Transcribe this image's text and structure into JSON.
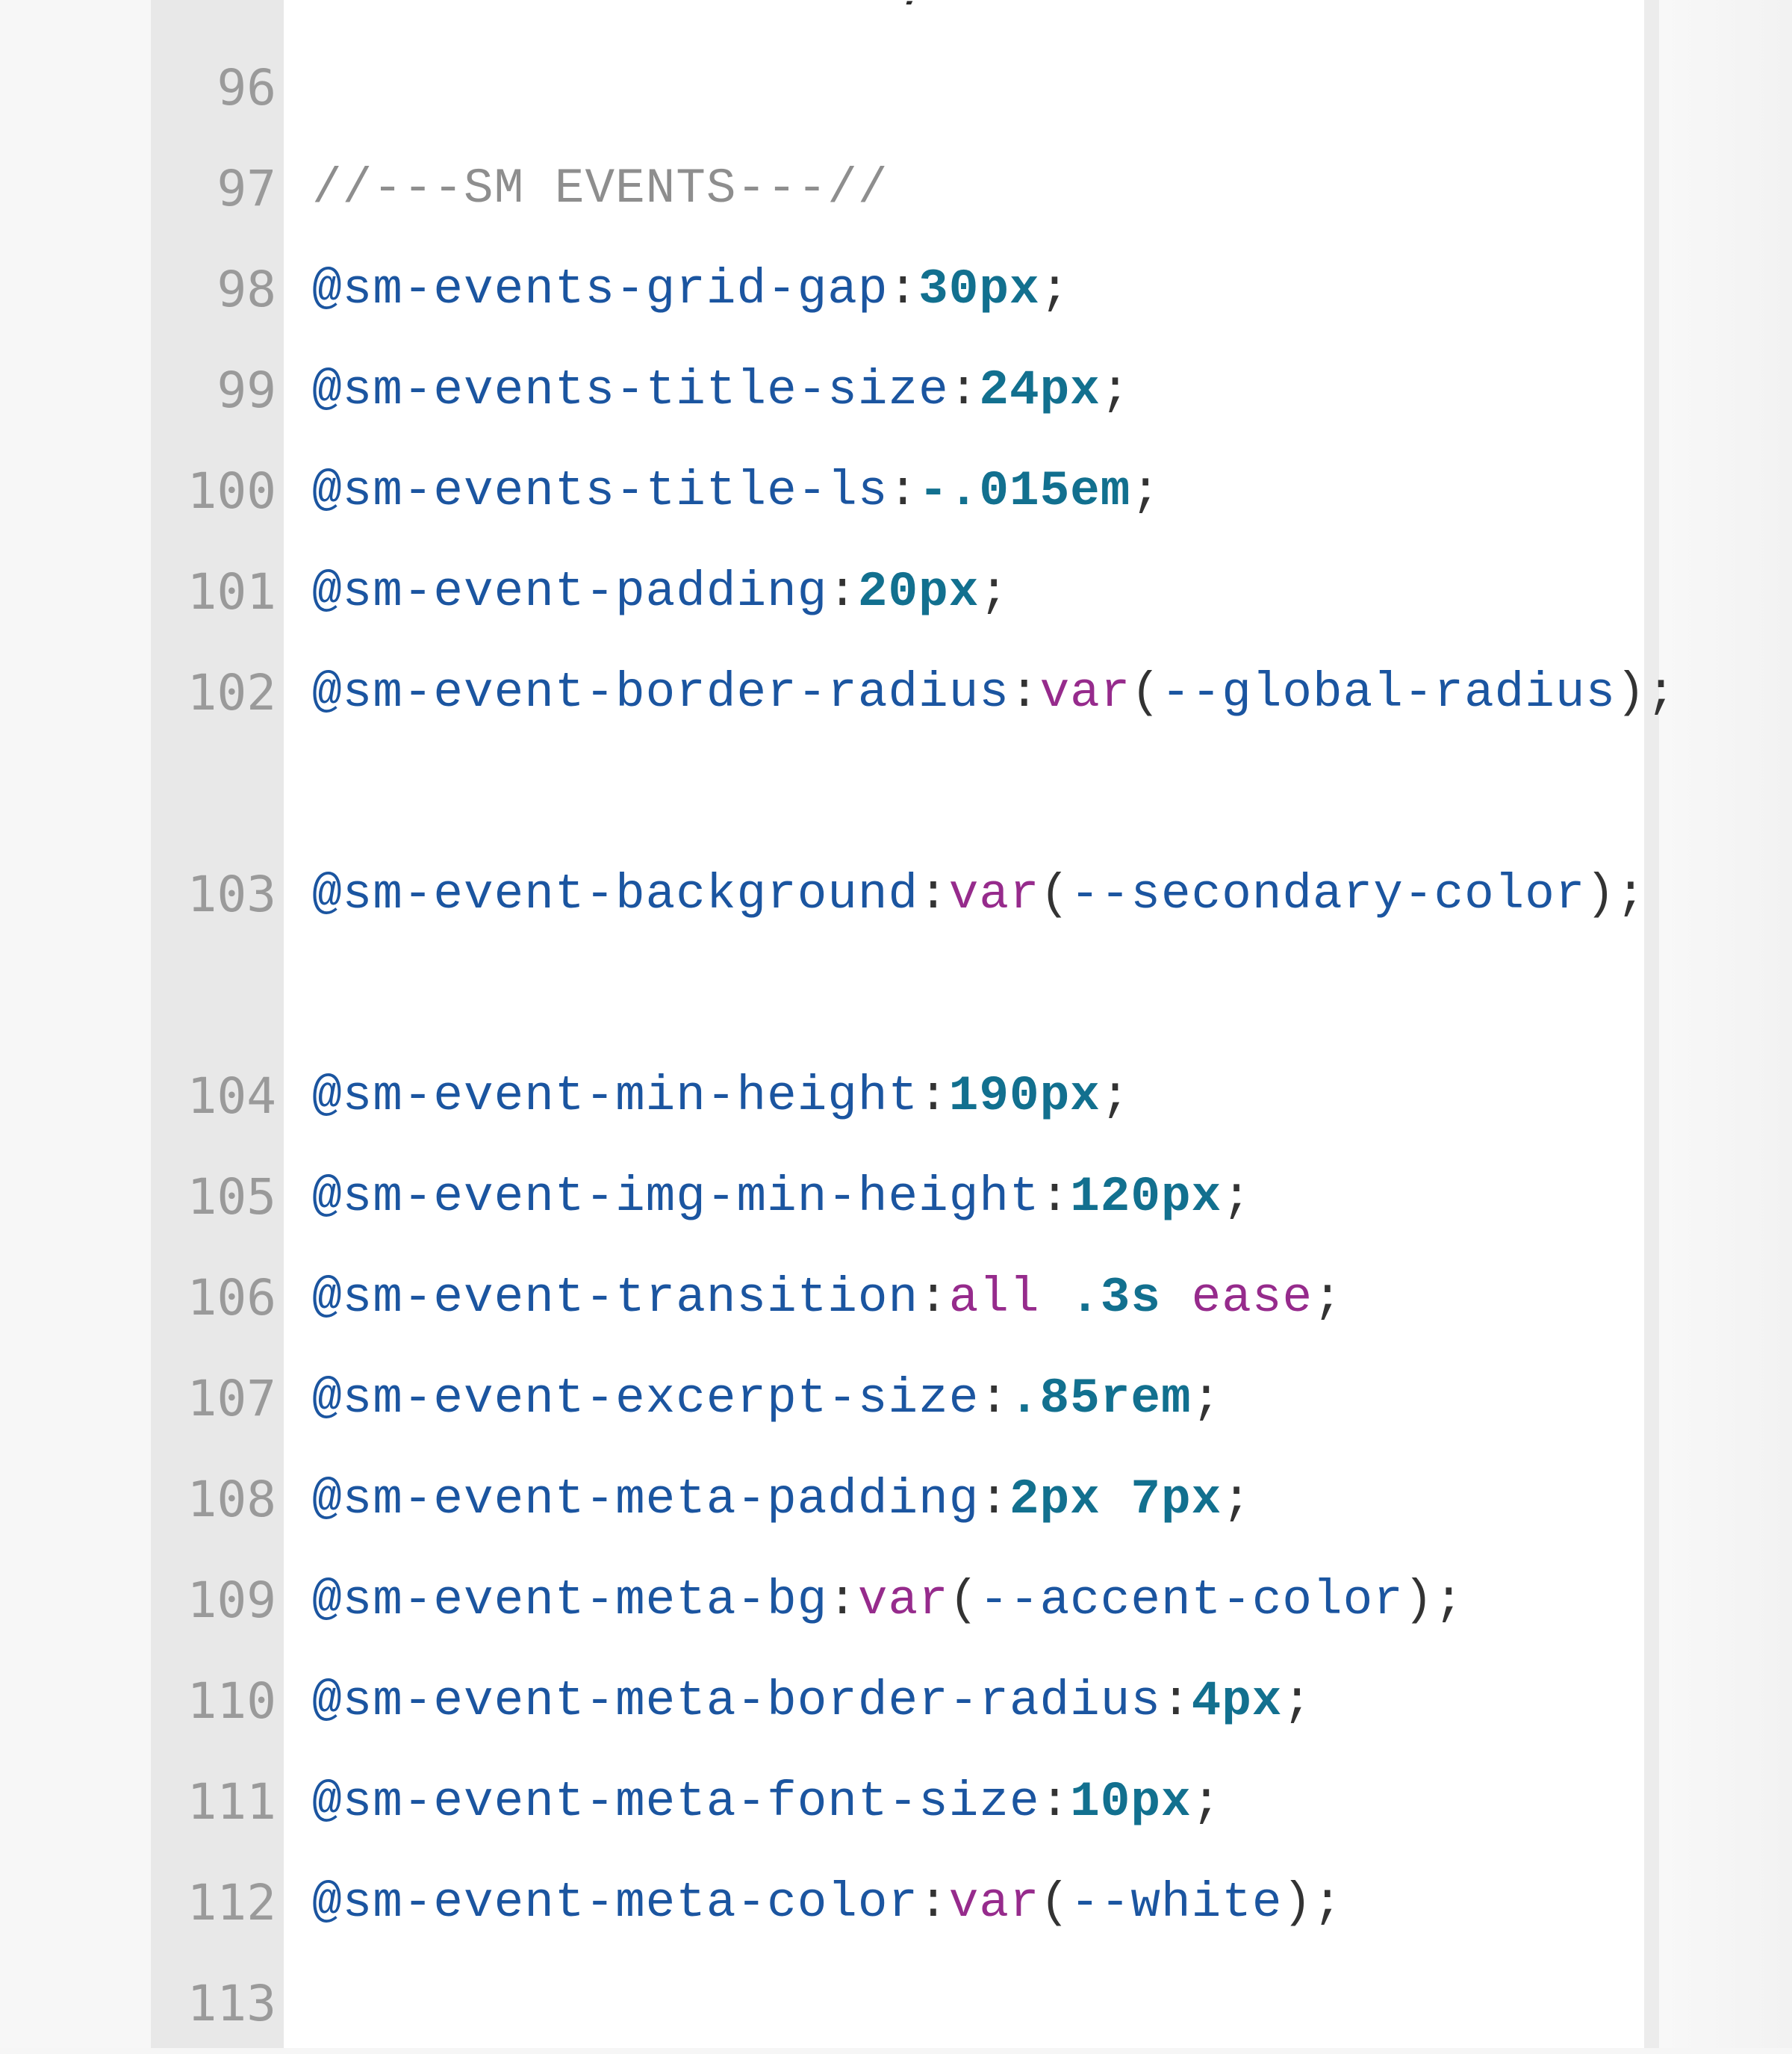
{
  "editor": {
    "top_partial_text": ";",
    "lines": [
      {
        "num": "96",
        "tokens": []
      },
      {
        "num": "97",
        "tokens": [
          {
            "t": "cm",
            "v": "//---SM EVENTS---//"
          }
        ]
      },
      {
        "num": "98",
        "tokens": [
          {
            "t": "vn",
            "v": "@sm-events-grid-gap"
          },
          {
            "t": "pn",
            "v": ":"
          },
          {
            "t": "nm",
            "v": "30px"
          },
          {
            "t": "pn",
            "v": ";"
          }
        ]
      },
      {
        "num": "99",
        "tokens": [
          {
            "t": "vn",
            "v": "@sm-events-title-size"
          },
          {
            "t": "pn",
            "v": ":"
          },
          {
            "t": "nm",
            "v": "24px"
          },
          {
            "t": "pn",
            "v": ";"
          }
        ]
      },
      {
        "num": "100",
        "tokens": [
          {
            "t": "vn",
            "v": "@sm-events-title-ls"
          },
          {
            "t": "pn",
            "v": ":"
          },
          {
            "t": "nm",
            "v": "-.015em"
          },
          {
            "t": "pn",
            "v": ";"
          }
        ]
      },
      {
        "num": "101",
        "tokens": [
          {
            "t": "vn",
            "v": "@sm-event-padding"
          },
          {
            "t": "pn",
            "v": ":"
          },
          {
            "t": "nm",
            "v": "20px"
          },
          {
            "t": "pn",
            "v": ";"
          }
        ]
      },
      {
        "num": "102",
        "wrap": true,
        "tokens": [
          {
            "t": "vn",
            "v": "@sm-event-border-radius"
          },
          {
            "t": "pn",
            "v": ":"
          },
          {
            "t": "kw",
            "v": "var"
          },
          {
            "t": "pn",
            "v": "("
          },
          {
            "t": "vn",
            "v": "--global-radius"
          },
          {
            "t": "pn",
            "v": ");"
          }
        ]
      },
      {
        "num": "103",
        "wrap": true,
        "tokens": [
          {
            "t": "vn",
            "v": "@sm-event-background"
          },
          {
            "t": "pn",
            "v": ":"
          },
          {
            "t": "kw",
            "v": "var"
          },
          {
            "t": "pn",
            "v": "("
          },
          {
            "t": "vn",
            "v": "--secondary-color"
          },
          {
            "t": "pn",
            "v": ");"
          }
        ]
      },
      {
        "num": "104",
        "tokens": [
          {
            "t": "vn",
            "v": "@sm-event-min-height"
          },
          {
            "t": "pn",
            "v": ":"
          },
          {
            "t": "nm",
            "v": "190px"
          },
          {
            "t": "pn",
            "v": ";"
          }
        ]
      },
      {
        "num": "105",
        "tokens": [
          {
            "t": "vn",
            "v": "@sm-event-img-min-height"
          },
          {
            "t": "pn",
            "v": ":"
          },
          {
            "t": "nm",
            "v": "120px"
          },
          {
            "t": "pn",
            "v": ";"
          }
        ]
      },
      {
        "num": "106",
        "tokens": [
          {
            "t": "vn",
            "v": "@sm-event-transition"
          },
          {
            "t": "pn",
            "v": ":"
          },
          {
            "t": "kw",
            "v": "all"
          },
          {
            "t": "pn",
            "v": " "
          },
          {
            "t": "nm",
            "v": ".3s"
          },
          {
            "t": "pn",
            "v": " "
          },
          {
            "t": "kw",
            "v": "ease"
          },
          {
            "t": "pn",
            "v": ";"
          }
        ]
      },
      {
        "num": "107",
        "tokens": [
          {
            "t": "vn",
            "v": "@sm-event-excerpt-size"
          },
          {
            "t": "pn",
            "v": ":"
          },
          {
            "t": "nm",
            "v": ".85rem"
          },
          {
            "t": "pn",
            "v": ";"
          }
        ]
      },
      {
        "num": "108",
        "tokens": [
          {
            "t": "vn",
            "v": "@sm-event-meta-padding"
          },
          {
            "t": "pn",
            "v": ":"
          },
          {
            "t": "nm",
            "v": "2px 7px"
          },
          {
            "t": "pn",
            "v": ";"
          }
        ]
      },
      {
        "num": "109",
        "tokens": [
          {
            "t": "vn",
            "v": "@sm-event-meta-bg"
          },
          {
            "t": "pn",
            "v": ":"
          },
          {
            "t": "kw",
            "v": "var"
          },
          {
            "t": "pn",
            "v": "("
          },
          {
            "t": "vn",
            "v": "--accent-color"
          },
          {
            "t": "pn",
            "v": ");"
          }
        ]
      },
      {
        "num": "110",
        "tokens": [
          {
            "t": "vn",
            "v": "@sm-event-meta-border-radius"
          },
          {
            "t": "pn",
            "v": ":"
          },
          {
            "t": "nm",
            "v": "4px"
          },
          {
            "t": "pn",
            "v": ";"
          }
        ]
      },
      {
        "num": "111",
        "tokens": [
          {
            "t": "vn",
            "v": "@sm-event-meta-font-size"
          },
          {
            "t": "pn",
            "v": ":"
          },
          {
            "t": "nm",
            "v": "10px"
          },
          {
            "t": "pn",
            "v": ";"
          }
        ]
      },
      {
        "num": "112",
        "tokens": [
          {
            "t": "vn",
            "v": "@sm-event-meta-color"
          },
          {
            "t": "pn",
            "v": ":"
          },
          {
            "t": "kw",
            "v": "var"
          },
          {
            "t": "pn",
            "v": "("
          },
          {
            "t": "vn",
            "v": "--white"
          },
          {
            "t": "pn",
            "v": ");"
          }
        ]
      },
      {
        "num": "113",
        "tokens": []
      }
    ]
  },
  "colors": {
    "comment": "#8e8e8e",
    "variable": "#1b55a0",
    "number": "#12708f",
    "keyword": "#962b8c",
    "punctuation": "#333333",
    "line_number": "#9a9a9a",
    "gutter_bg": "#e8e8e8",
    "editor_bg": "#ffffff"
  }
}
